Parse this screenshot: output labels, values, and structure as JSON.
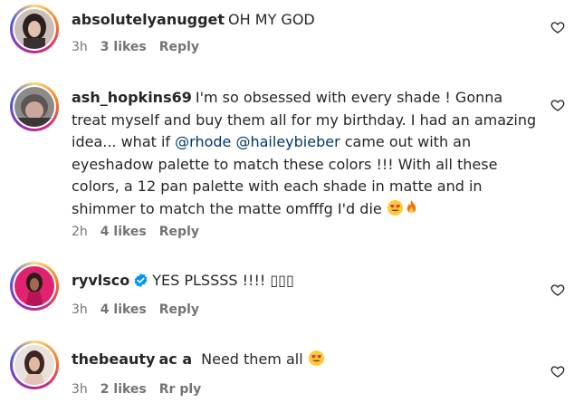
{
  "comments": [
    {
      "username": "absolutelyanugget",
      "text": "OH MY GOD",
      "time": "3h",
      "likes": "3 likes",
      "reply": "Reply"
    },
    {
      "username": "ash_hopkins69",
      "text_parts": [
        "I'm so obsessed with every shade ! Gonna treat myself and buy them all for my birthday. I had an amazing idea... what if ",
        "@rhode",
        " ",
        "@haileybieber",
        " came out with an eyeshadow palette to match these colors !!! With all these colors, a 12 pan palette with each shade in matte and in shimmer to match the matte omfffg I'd die "
      ],
      "emojis": [
        "heart-eyes-emoji",
        "fire-emoji"
      ],
      "time": "2h",
      "likes": "4 likes",
      "reply": "Reply"
    },
    {
      "username": "ryvlsco",
      "verified": true,
      "text": "YES PLSSSS !!!! ▯▯▯",
      "time": "3h",
      "likes": "4 likes",
      "reply": "Reply"
    },
    {
      "username": "thebeauty",
      "username_tail": "ac a",
      "text": "Need them all",
      "emojis": [
        "heart-eyes-emoji"
      ],
      "time": "3h",
      "likes": "2 likes",
      "reply": "Rr  ply"
    }
  ],
  "icons": {
    "like": "heart-outline-icon",
    "verified": "verified-badge-icon"
  },
  "colors": {
    "text": "#262626",
    "meta": "#737373",
    "mention": "#00376b",
    "verified": "#0095f6"
  }
}
